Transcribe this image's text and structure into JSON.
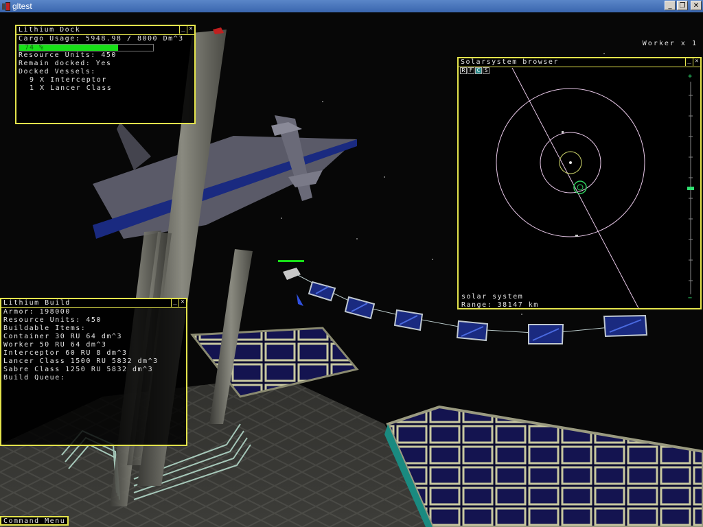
{
  "window": {
    "title": "gltest",
    "controls": {
      "minimize": "_",
      "maximize": "❐",
      "close": "✕"
    }
  },
  "dock": {
    "title": "Lithium Dock",
    "cargo_usage": "Cargo Usage: 5948.98 / 8000 Dm^3",
    "cargo_percent_label": "74 %",
    "cargo_fraction": 0.74,
    "resource_units": "Resource Units: 450",
    "remain_docked": "Remain docked: Yes",
    "docked_vessels_label": "Docked Vessels:",
    "vessels": [
      "9 X Interceptor",
      "1 X Lancer Class"
    ]
  },
  "worker_label": "Worker x 1",
  "browser": {
    "title": "Solarsystem browser",
    "tabs": [
      "R",
      "F",
      "C",
      "S"
    ],
    "active_tab": "C",
    "view_label": "solar system",
    "range": "Range: 38147 km",
    "zoom_top": "+",
    "zoom_bottom": "−",
    "zoom_level": 0.5
  },
  "build": {
    "title": "Lithium Build",
    "armor": "Armor: 198000",
    "resource_units": "Resource Units: 450",
    "buildable_label": "Buildable Items:",
    "items": [
      "Container 30 RU 64 dm^3",
      "Worker 50 RU 64 dm^3",
      "Interceptor 60 RU 8 dm^3",
      "Lancer Class 1500 RU 5832 dm^3",
      "Sabre Class 1250 RU 5832 dm^3"
    ],
    "queue_label": "Build Queue:"
  },
  "command_menu": "Command Menu",
  "panel_controls": {
    "minimize": "_",
    "close": "✕"
  },
  "colors": {
    "panel_border": "#e4e44c",
    "cargo_fill": "#18e018",
    "orbit": "#e8c8e8",
    "active_tab": "#2a8a8a"
  }
}
